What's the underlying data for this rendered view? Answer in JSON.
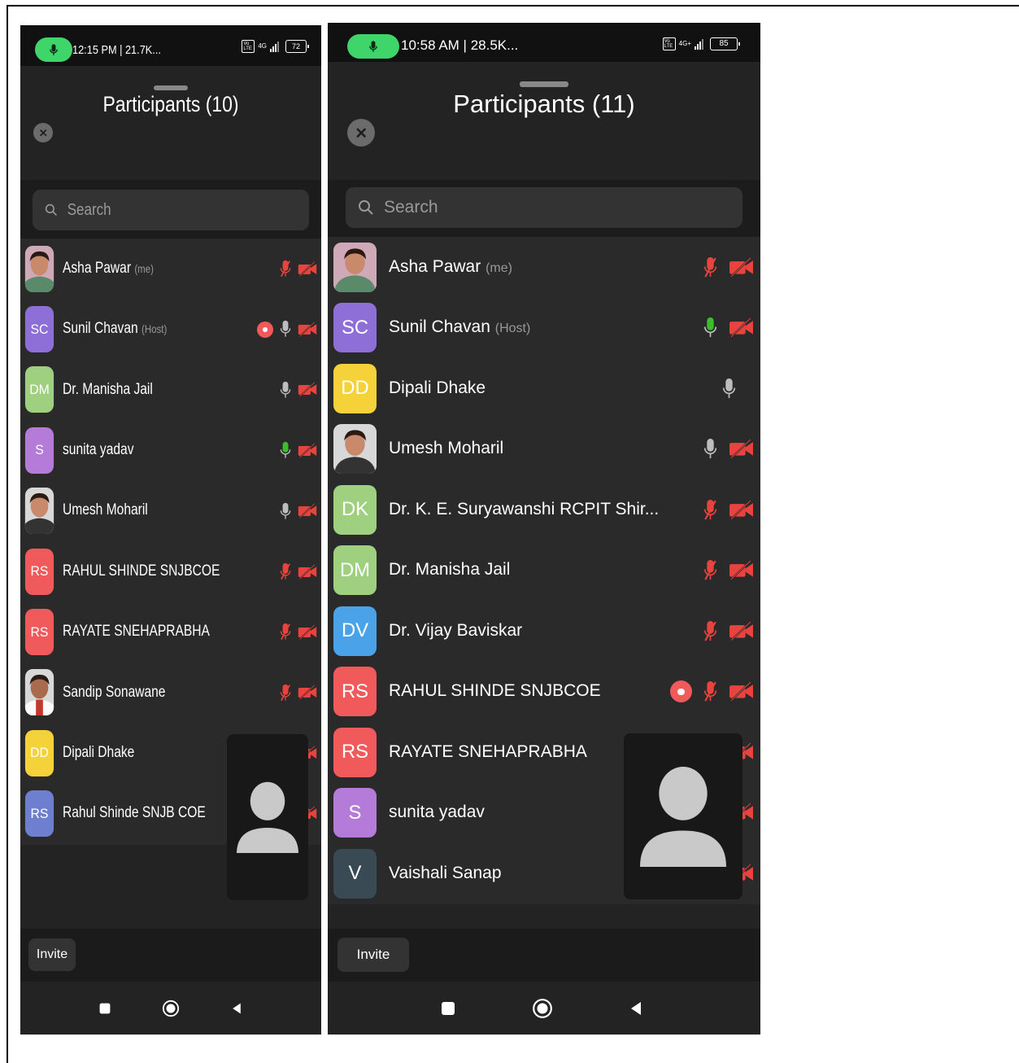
{
  "phones": [
    {
      "status": {
        "time": "12:15 PM | 21.7K...",
        "volte": "Vo LTE",
        "network": "4G",
        "battery": "72"
      },
      "header": {
        "title": "Participants (10)"
      },
      "search": {
        "placeholder": "Search"
      },
      "participants": [
        {
          "initials": "",
          "avatar": "photo-asha",
          "name": "Asha Pawar",
          "tag": "(me)",
          "recording": false,
          "mic": "muted",
          "video": "off"
        },
        {
          "initials": "SC",
          "color": "#8e6fd8",
          "name": "Sunil Chavan",
          "tag": "(Host)",
          "recording": true,
          "mic": "on",
          "video": "off"
        },
        {
          "initials": "DM",
          "color": "#9ed080",
          "name": "Dr. Manisha Jail",
          "tag": "",
          "recording": false,
          "mic": "on",
          "video": "off"
        },
        {
          "initials": "S",
          "color": "#b57bd8",
          "name": "sunita  yadav",
          "tag": "",
          "recording": false,
          "mic": "speaking",
          "video": "off"
        },
        {
          "initials": "",
          "avatar": "photo-umesh",
          "name": "Umesh Moharil",
          "tag": "",
          "recording": false,
          "mic": "on",
          "video": "off"
        },
        {
          "initials": "RS",
          "color": "#f05a5a",
          "name": "RAHUL SHINDE SNJBCOE",
          "tag": "",
          "recording": false,
          "mic": "muted",
          "video": "off"
        },
        {
          "initials": "RS",
          "color": "#f05a5a",
          "name": "RAYATE SNEHAPRABHA",
          "tag": "",
          "recording": false,
          "mic": "muted",
          "video": "off"
        },
        {
          "initials": "",
          "avatar": "photo-sandip",
          "name": "Sandip Sonawane",
          "tag": "",
          "recording": false,
          "mic": "muted",
          "video": "off"
        },
        {
          "initials": "DD",
          "color": "#f5d23a",
          "name": "Dipali Dhake",
          "tag": "",
          "recording": false,
          "mic": "hidden",
          "video": "off"
        },
        {
          "initials": "RS",
          "color": "#6f7fd0",
          "name": "Rahul Shinde SNJB COE",
          "tag": "",
          "recording": false,
          "mic": "hidden",
          "video": "off"
        }
      ],
      "footer": {
        "invite_label": "Invite"
      }
    },
    {
      "status": {
        "time": "10:58 AM | 28.5K...",
        "volte": "Vo LTE",
        "network": "4G+",
        "battery": "85"
      },
      "header": {
        "title": "Participants (11)"
      },
      "search": {
        "placeholder": "Search"
      },
      "participants": [
        {
          "initials": "",
          "avatar": "photo-asha",
          "name": "Asha Pawar",
          "tag": "(me)",
          "recording": false,
          "mic": "muted",
          "video": "off"
        },
        {
          "initials": "SC",
          "color": "#8e6fd8",
          "name": "Sunil Chavan",
          "tag": "(Host)",
          "recording": false,
          "mic": "speaking",
          "video": "off"
        },
        {
          "initials": "DD",
          "color": "#f5d23a",
          "name": "Dipali Dhake",
          "tag": "",
          "recording": false,
          "mic": "on",
          "video": "none"
        },
        {
          "initials": "",
          "avatar": "photo-umesh",
          "name": "Umesh Moharil",
          "tag": "",
          "recording": false,
          "mic": "on",
          "video": "off"
        },
        {
          "initials": "DK",
          "color": "#9ed080",
          "name": "Dr. K. E. Suryawanshi RCPIT Shir...",
          "tag": "",
          "recording": false,
          "mic": "muted",
          "video": "off"
        },
        {
          "initials": "DM",
          "color": "#9ed080",
          "name": "Dr. Manisha Jail",
          "tag": "",
          "recording": false,
          "mic": "muted",
          "video": "off"
        },
        {
          "initials": "DV",
          "color": "#4aa3e8",
          "name": "Dr. Vijay Baviskar",
          "tag": "",
          "recording": false,
          "mic": "muted",
          "video": "off"
        },
        {
          "initials": "RS",
          "color": "#f05a5a",
          "name": "RAHUL SHINDE SNJBCOE",
          "tag": "",
          "recording": true,
          "mic": "muted",
          "video": "off"
        },
        {
          "initials": "RS",
          "color": "#f05a5a",
          "name": "RAYATE SNEHAPRABHA",
          "tag": "",
          "recording": false,
          "mic": "hidden",
          "video": "off"
        },
        {
          "initials": "S",
          "color": "#b57bd8",
          "name": "sunita  yadav",
          "tag": "",
          "recording": false,
          "mic": "hidden",
          "video": "off"
        },
        {
          "initials": "V",
          "color": "#3a4a55",
          "name": "Vaishali Sanap",
          "tag": "",
          "recording": false,
          "mic": "hidden",
          "video": "off"
        }
      ],
      "footer": {
        "invite_label": "Invite"
      }
    }
  ],
  "colors": {
    "accent_green": "#3ed56b",
    "muted_red": "#e8433f",
    "speaking_green": "#3bbd2c"
  }
}
